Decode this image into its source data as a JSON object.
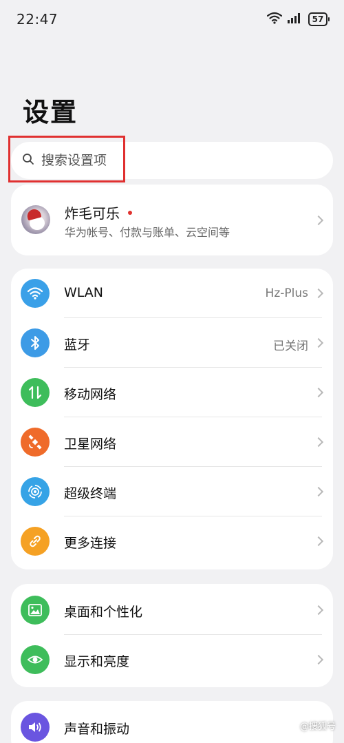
{
  "status_bar": {
    "time": "22:47",
    "battery": "57"
  },
  "title": "设置",
  "search": {
    "placeholder": "搜索设置项"
  },
  "account": {
    "name": "炸毛可乐",
    "subtitle": "华为帐号、付款与账单、云空间等"
  },
  "network_items": [
    {
      "label": "WLAN",
      "value": "Hz-Plus",
      "icon": "wifi-icon",
      "color": "#3aa0e8"
    },
    {
      "label": "蓝牙",
      "value": "已关闭",
      "icon": "bluetooth-icon",
      "color": "#3d9be6"
    },
    {
      "label": "移动网络",
      "value": "",
      "icon": "mobile-data-icon",
      "color": "#3ebd5b"
    },
    {
      "label": "卫星网络",
      "value": "",
      "icon": "satellite-icon",
      "color": "#ef6b2a"
    },
    {
      "label": "超级终端",
      "value": "",
      "icon": "super-device-icon",
      "color": "#36a3e6"
    },
    {
      "label": "更多连接",
      "value": "",
      "icon": "link-icon",
      "color": "#f5a124"
    }
  ],
  "display_items": [
    {
      "label": "桌面和个性化",
      "icon": "wallpaper-icon",
      "color": "#3ebd5b"
    },
    {
      "label": "显示和亮度",
      "icon": "eye-icon",
      "color": "#3ebd5b"
    }
  ],
  "sound_items": [
    {
      "label": "声音和振动",
      "icon": "speaker-icon",
      "color": "#6a55e0"
    }
  ],
  "watermark": "@搜狐号"
}
